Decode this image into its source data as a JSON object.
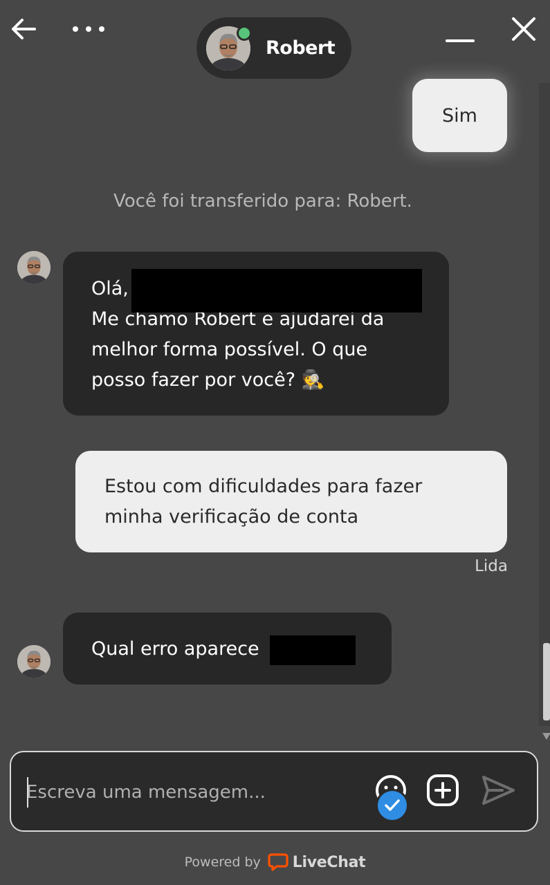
{
  "header": {
    "agent_name": "Robert",
    "agent_status": "online",
    "icons": [
      "back-arrow-icon",
      "more-options-icon",
      "minimize-icon",
      "close-icon"
    ]
  },
  "messages": [
    {
      "from": "visitor",
      "text": "Sim"
    },
    {
      "from": "system",
      "text": "Você foi transferido para: Robert."
    },
    {
      "from": "agent",
      "lines": [
        "Olá,",
        "Me chamo Robert e ajudarei da",
        "melhor forma possível. O que",
        "posso fazer por você? 🕵️"
      ]
    },
    {
      "from": "visitor",
      "lines": [
        "Estou com dificuldades para fazer",
        "minha verificação de conta"
      ],
      "status": "Lida"
    },
    {
      "from": "agent",
      "text_before": "Qual erro aparece",
      "text_after": "?"
    }
  ],
  "composer": {
    "placeholder": "Escreva uma mensagem...",
    "icons": [
      "emoji-icon",
      "attach-plus-icon",
      "send-icon"
    ]
  },
  "footer": {
    "powered_by": "Powered by",
    "brand": "LiveChat"
  },
  "colors": {
    "background": "#474747",
    "agent_bubble": "#272727",
    "visitor_bubble": "#eeeeee",
    "online_dot": "#58c37a",
    "livechat_orange": "#ff5100",
    "badge_blue": "#2f8de4"
  }
}
